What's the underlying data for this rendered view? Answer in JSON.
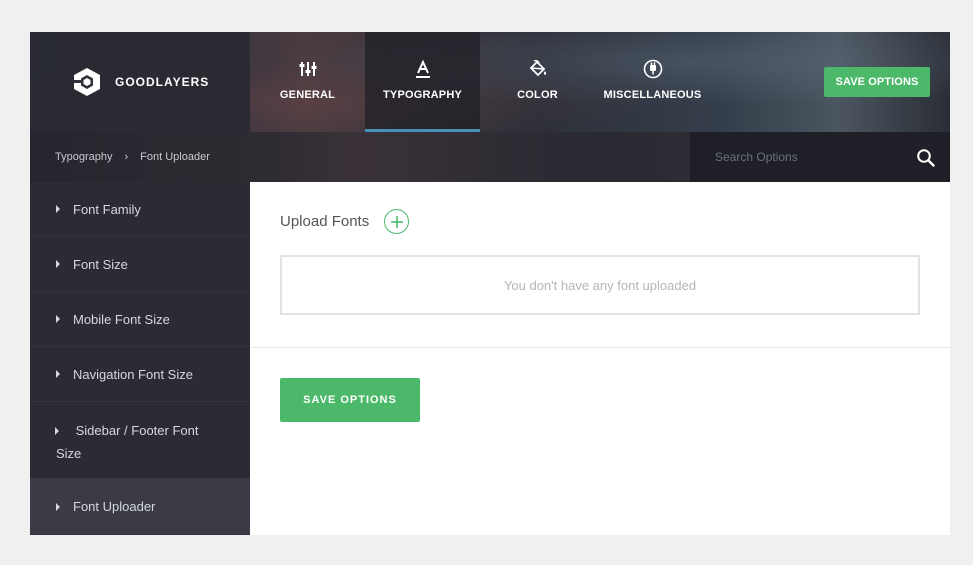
{
  "brand": {
    "name": "GOODLAYERS",
    "icon": "goodlayers-logo-icon"
  },
  "nav": {
    "tabs": [
      {
        "label": "GENERAL",
        "icon": "sliders-icon",
        "active": false
      },
      {
        "label": "TYPOGRAPHY",
        "icon": "font-icon",
        "active": true
      },
      {
        "label": "COLOR",
        "icon": "paint-bucket-icon",
        "active": false
      },
      {
        "label": "MISCELLANEOUS",
        "icon": "plug-icon",
        "active": false
      }
    ],
    "save_label": "SAVE OPTIONS"
  },
  "breadcrumb": {
    "parent": "Typography",
    "separator": "›",
    "current": "Font Uploader"
  },
  "search": {
    "placeholder": "Search Options",
    "value": ""
  },
  "sidebar": {
    "items": [
      {
        "label": "Font Family",
        "active": false
      },
      {
        "label": "Font Size",
        "active": false
      },
      {
        "label": "Mobile Font Size",
        "active": false
      },
      {
        "label": "Navigation Font Size",
        "active": false
      },
      {
        "label": "Sidebar / Footer Font Size",
        "active": false
      },
      {
        "label": "Font Uploader",
        "active": true
      }
    ]
  },
  "main": {
    "upload_label": "Upload Fonts",
    "empty_message": "You don't have any font uploaded",
    "save_label": "SAVE OPTIONS"
  },
  "colors": {
    "accent_green": "#4cb96a",
    "active_tab_underline": "#4a8fb8",
    "sidebar_bg": "#2a2b33",
    "sidebar_active_bg": "#3a3b45"
  }
}
